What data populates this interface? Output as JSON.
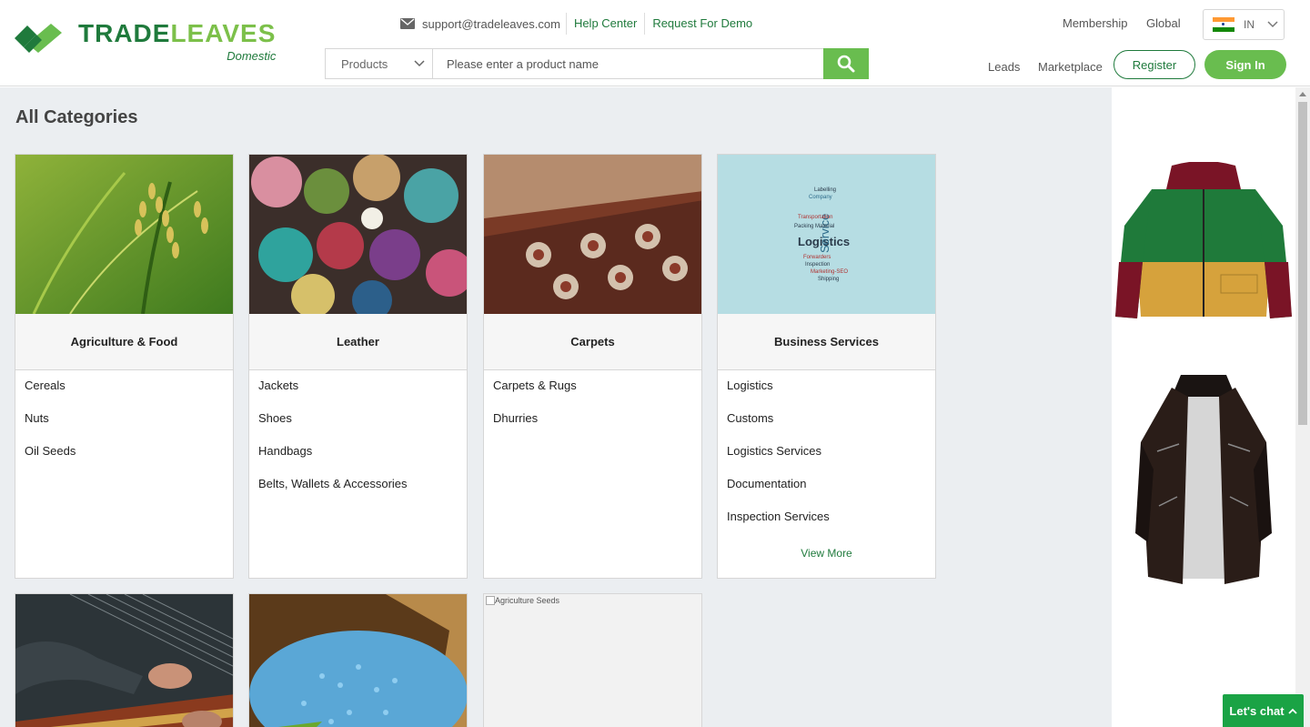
{
  "header": {
    "logo": {
      "title_part1": "TRADE",
      "title_part2": "LEAVES",
      "subtitle": "Domestic"
    },
    "email": "support@tradeleaves.com",
    "help_center": "Help Center",
    "request_demo": "Request For Demo",
    "search": {
      "category": "Products",
      "placeholder": "Please enter a product name"
    },
    "membership": "Membership",
    "global": "Global",
    "country": "IN",
    "leads": "Leads",
    "marketplace": "Marketplace",
    "register": "Register",
    "sign_in": "Sign In"
  },
  "main": {
    "title": "All Categories",
    "categories": [
      {
        "name": "Agriculture & Food",
        "items": [
          "Cereals",
          "Nuts",
          "Oil Seeds"
        ]
      },
      {
        "name": "Leather",
        "items": [
          "Jackets",
          "Shoes",
          "Handbags",
          "Belts, Wallets & Accessories"
        ]
      },
      {
        "name": "Carpets",
        "items": [
          "Carpets & Rugs",
          "Dhurries"
        ]
      },
      {
        "name": "Business Services",
        "items": [
          "Logistics",
          "Customs",
          "Logistics Services",
          "Documentation",
          "Inspection Services"
        ],
        "more": "View More"
      }
    ],
    "broken_image_alt": "Agriculture Seeds",
    "word_cloud": [
      "Logistics",
      "Service",
      "Packing Material",
      "Forwarders",
      "Inspection",
      "Marketing-SEO",
      "Shipping",
      "Transportation",
      "Company",
      "Labelling"
    ]
  },
  "chat": {
    "label": "Let's chat"
  },
  "colors": {
    "brand_dark": "#1f7a3c",
    "brand_light": "#69bd4f",
    "chat": "#1aa345",
    "background": "#ebeef1"
  }
}
